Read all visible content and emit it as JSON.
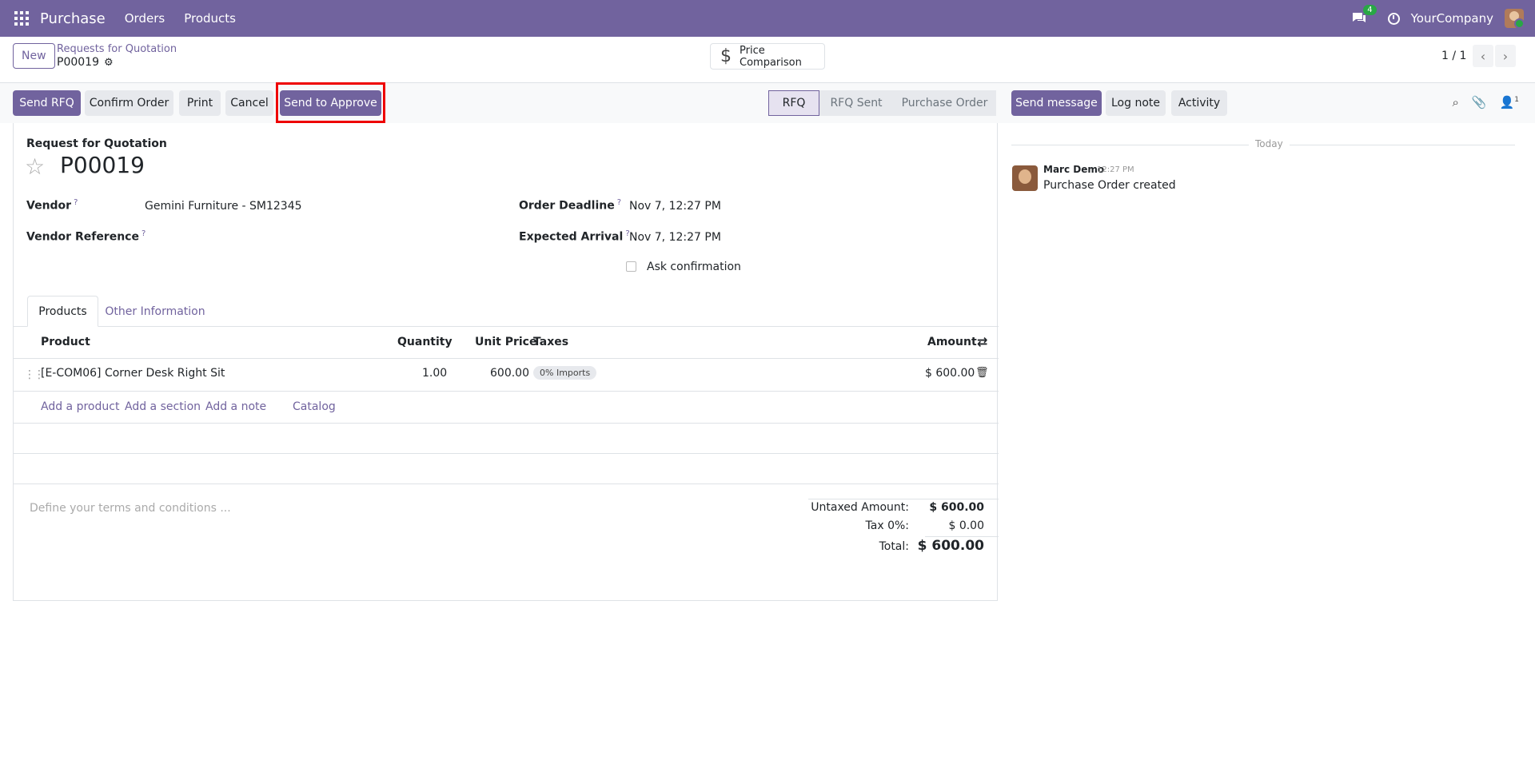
{
  "navbar": {
    "brand": "Purchase",
    "menu": [
      "Orders",
      "Products"
    ],
    "chat_count": "4",
    "company": "YourCompany"
  },
  "control_panel": {
    "new_label": "New",
    "breadcrumb": "Requests for Quotation",
    "record": "P00019",
    "price_comparison": "Price Comparison",
    "pager": "1 / 1"
  },
  "actions": {
    "send_rfq": "Send RFQ",
    "confirm_order": "Confirm Order",
    "print": "Print",
    "cancel": "Cancel",
    "send_to_approve": "Send to Approve"
  },
  "status": [
    "RFQ",
    "RFQ Sent",
    "Purchase Order"
  ],
  "chatter": {
    "send_message": "Send message",
    "log_note": "Log note",
    "activity": "Activity",
    "followers_count": "1",
    "today": "Today",
    "message": {
      "author": "Marc Demo",
      "time": "12:27 PM",
      "body": "Purchase Order created"
    }
  },
  "form": {
    "header_label": "Request for Quotation",
    "name": "P00019",
    "vendor_label": "Vendor",
    "vendor_value": "Gemini Furniture - SM12345",
    "vendor_ref_label": "Vendor Reference",
    "order_deadline_label": "Order Deadline",
    "order_deadline_value": "Nov 7, 12:27 PM",
    "expected_arrival_label": "Expected Arrival",
    "expected_arrival_value": "Nov 7, 12:27 PM",
    "ask_confirmation": "Ask confirmation",
    "help_mark": "?"
  },
  "tabs": [
    "Products",
    "Other Information"
  ],
  "table": {
    "headers": {
      "product": "Product",
      "quantity": "Quantity",
      "unit_price": "Unit Price",
      "taxes": "Taxes",
      "amount": "Amount"
    },
    "rows": [
      {
        "product": "[E-COM06] Corner Desk Right Sit",
        "quantity": "1.00",
        "unit_price": "600.00",
        "tax": "0% Imports",
        "amount": "$ 600.00"
      }
    ],
    "add_links": [
      "Add a product",
      "Add a section",
      "Add a note",
      "Catalog"
    ]
  },
  "terms_placeholder": "Define your terms and conditions ...",
  "totals": {
    "untaxed_label": "Untaxed Amount:",
    "untaxed_value": "$ 600.00",
    "tax_label": "Tax 0%:",
    "tax_value": "$ 0.00",
    "total_label": "Total:",
    "total_value": "$ 600.00"
  },
  "colors": {
    "brand": "#71639e",
    "highlight": "#e00000",
    "badge_green": "#28a745"
  }
}
